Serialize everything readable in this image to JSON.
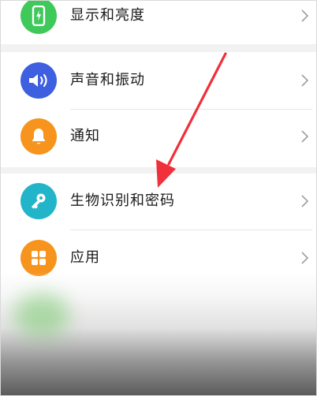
{
  "settings": {
    "items": [
      {
        "label": "显示和亮度",
        "icon": "phone-brightness-icon",
        "color": "#3ec95a"
      },
      {
        "label": "声音和振动",
        "icon": "speaker-icon",
        "color": "#3d5fe0"
      },
      {
        "label": "通知",
        "icon": "bell-icon",
        "color": "#f7941d"
      },
      {
        "label": "生物识别和密码",
        "icon": "key-icon",
        "color": "#22b5c9"
      },
      {
        "label": "应用",
        "icon": "apps-grid-icon",
        "color": "#f7941d"
      }
    ]
  },
  "annotation": {
    "arrow_color": "#f0303a"
  }
}
